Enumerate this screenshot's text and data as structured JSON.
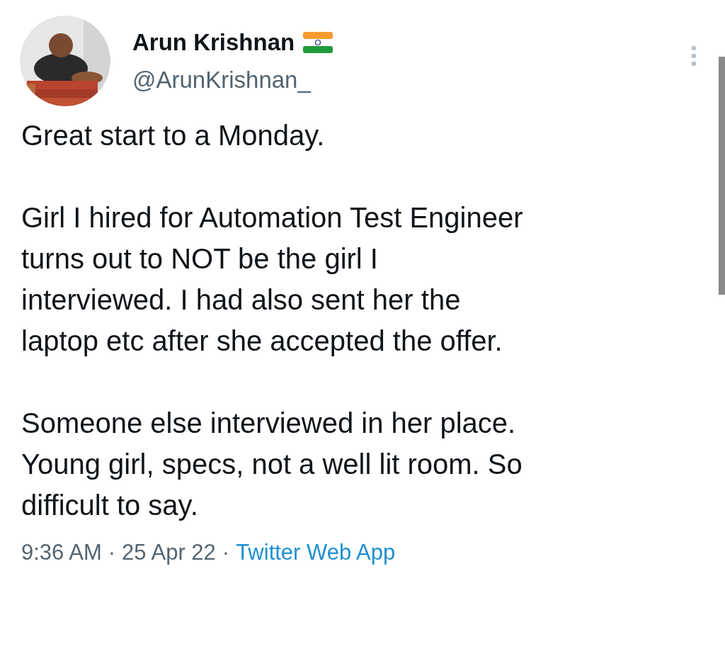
{
  "author": {
    "name": "Arun Krishnan",
    "handle": "@ArunKrishnan_"
  },
  "paragraphs": [
    {
      "lines": [
        "Great start to a Monday."
      ]
    },
    {
      "lines": [
        "Girl I hired for Automation Test Engineer",
        "turns out to NOT be the girl I",
        "interviewed. I had also sent her the",
        "laptop etc after she accepted the offer."
      ]
    },
    {
      "lines": [
        "Someone else interviewed in her place.",
        "Young girl, specs, not a well lit room. So",
        "difficult to say."
      ]
    }
  ],
  "meta": {
    "time": "9:36 AM",
    "separator_1": "·",
    "date": "25 Apr 22",
    "separator_2": "·",
    "source": "Twitter Web App"
  }
}
